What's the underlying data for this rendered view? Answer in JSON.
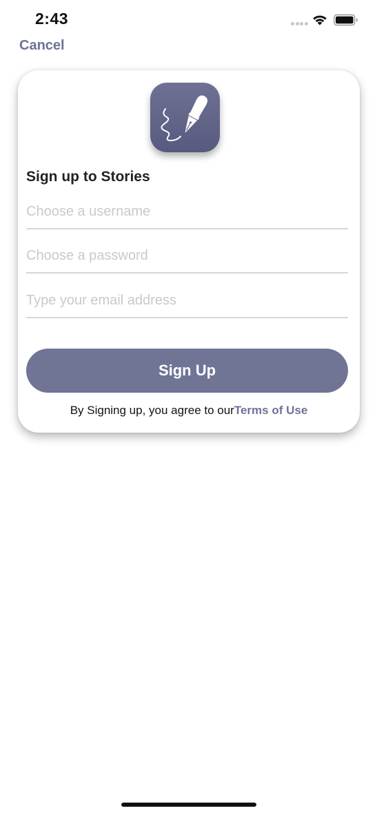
{
  "status_bar": {
    "time": "2:43",
    "icons": [
      "signal-icon",
      "wifi-icon",
      "battery-icon"
    ]
  },
  "nav": {
    "cancel_label": "Cancel"
  },
  "app": {
    "logo_icon": "fountain-pen-icon",
    "accent_color": "#707596"
  },
  "form": {
    "title": "Sign up to Stories",
    "username": {
      "value": "",
      "placeholder": "Choose a username"
    },
    "password": {
      "value": "",
      "placeholder": "Choose a password"
    },
    "email": {
      "value": "",
      "placeholder": "Type your email address"
    },
    "submit_label": "Sign Up",
    "terms_prefix": "By Signing up, you agree to our",
    "terms_link": "Terms of Use"
  }
}
